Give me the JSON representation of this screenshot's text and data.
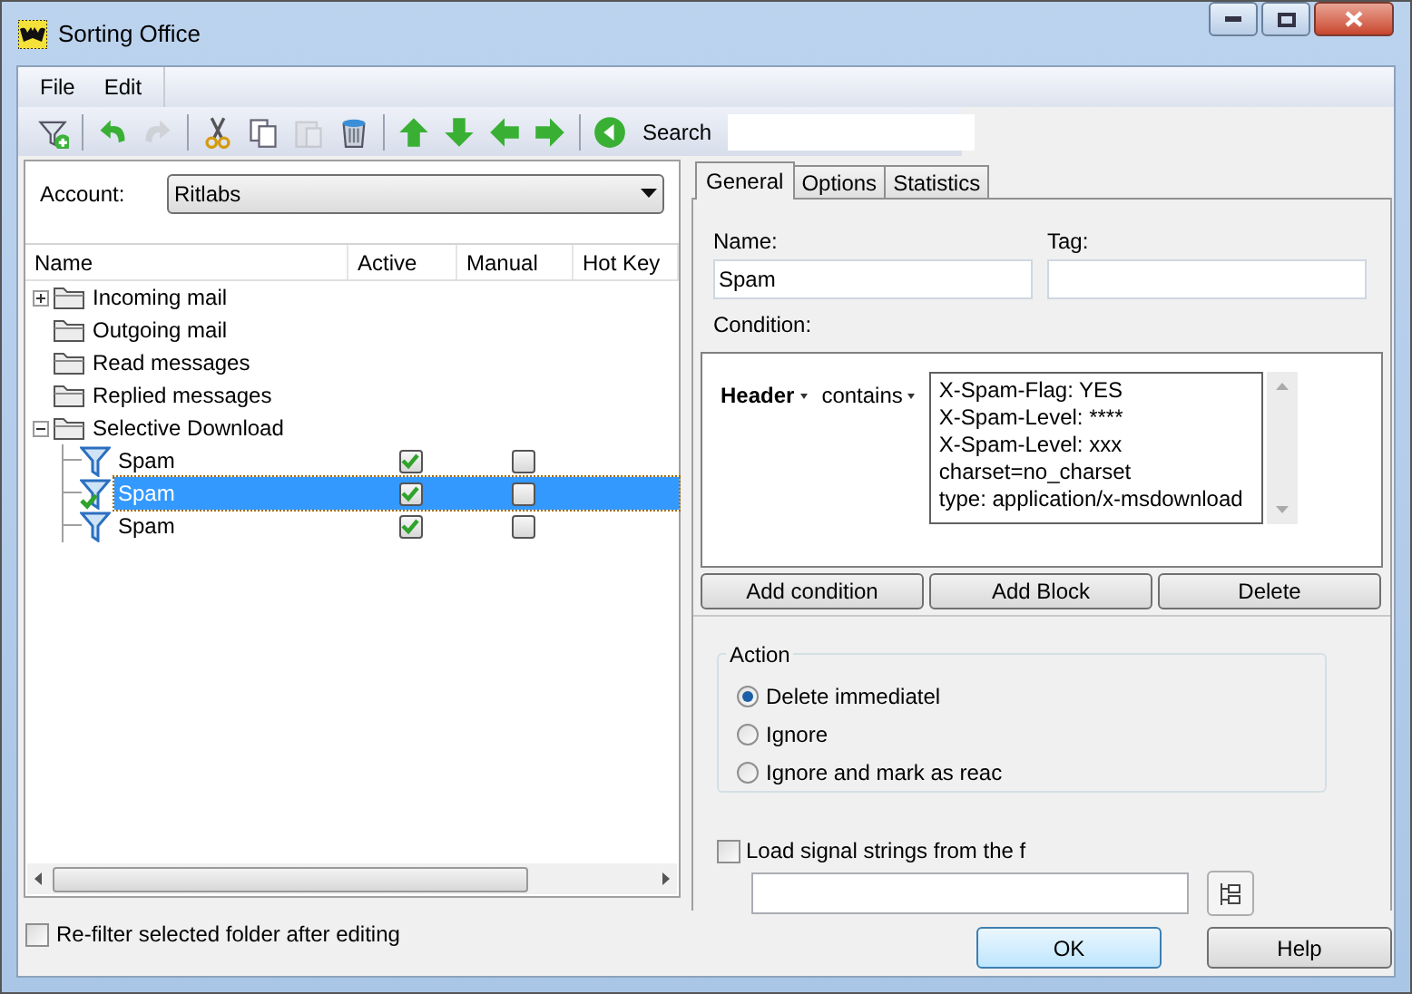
{
  "window": {
    "title": "Sorting Office"
  },
  "menu": [
    "File",
    "Edit"
  ],
  "toolbar": [
    {
      "kind": "filteradd",
      "disabled": false
    },
    {
      "kind": "sep"
    },
    {
      "kind": "undo",
      "disabled": false
    },
    {
      "kind": "redo",
      "disabled": true
    },
    {
      "kind": "sep"
    },
    {
      "kind": "cut",
      "disabled": false
    },
    {
      "kind": "copy",
      "disabled": false
    },
    {
      "kind": "paste",
      "disabled": true
    },
    {
      "kind": "trash",
      "disabled": false
    },
    {
      "kind": "sep"
    },
    {
      "kind": "up",
      "disabled": false
    },
    {
      "kind": "down",
      "disabled": false
    },
    {
      "kind": "left",
      "disabled": false
    },
    {
      "kind": "right",
      "disabled": false
    },
    {
      "kind": "sep"
    },
    {
      "kind": "back",
      "disabled": false
    }
  ],
  "search": {
    "label": "Search"
  },
  "account": {
    "label": "Account:",
    "value": "Ritlabs"
  },
  "tree": {
    "columns": [
      "Name",
      "Active",
      "Manual",
      "Hot Key"
    ],
    "items": [
      {
        "name": "Incoming mail",
        "expanded": false
      },
      {
        "name": "Outgoing mail"
      },
      {
        "name": "Read messages"
      },
      {
        "name": "Replied messages"
      },
      {
        "name": "Selective Download",
        "expanded": true,
        "children": [
          {
            "name": "Spam",
            "kind": "filter",
            "active": true,
            "manual": false,
            "selected": false,
            "marked": false
          },
          {
            "name": "Spam",
            "kind": "filter",
            "active": true,
            "manual": false,
            "selected": true,
            "marked": true
          },
          {
            "name": "Spam",
            "kind": "filter",
            "active": true,
            "manual": false,
            "selected": false,
            "marked": false
          }
        ]
      }
    ]
  },
  "tabs": [
    {
      "label": "General",
      "selected": true
    },
    {
      "label": "Options",
      "selected": false
    },
    {
      "label": "Statistics",
      "selected": false
    }
  ],
  "name_field": {
    "label": "Name:",
    "value": "Spam"
  },
  "tag_field": {
    "label": "Tag:"
  },
  "condition": {
    "label": "Condition:",
    "field": "Header",
    "operator": "contains",
    "lines": [
      "X-Spam-Flag: YES",
      "X-Spam-Level: ****",
      "X-Spam-Level: xxx",
      "charset=no_charset",
      "type: application/x-msdownload"
    ]
  },
  "condition_buttons": [
    "Add condition",
    "Add Block",
    "Delete"
  ],
  "action": {
    "title": "Action",
    "options": [
      {
        "label": "Delete immediatel",
        "selected": true
      },
      {
        "label": "Ignore",
        "selected": false
      },
      {
        "label": "Ignore and mark as reac",
        "selected": false
      }
    ]
  },
  "load_strings": {
    "label": "Load signal strings from the f",
    "checked": false
  },
  "refilter": {
    "label": "Re-filter selected folder after editing",
    "checked": false
  },
  "buttons": [
    "OK",
    "Help"
  ]
}
